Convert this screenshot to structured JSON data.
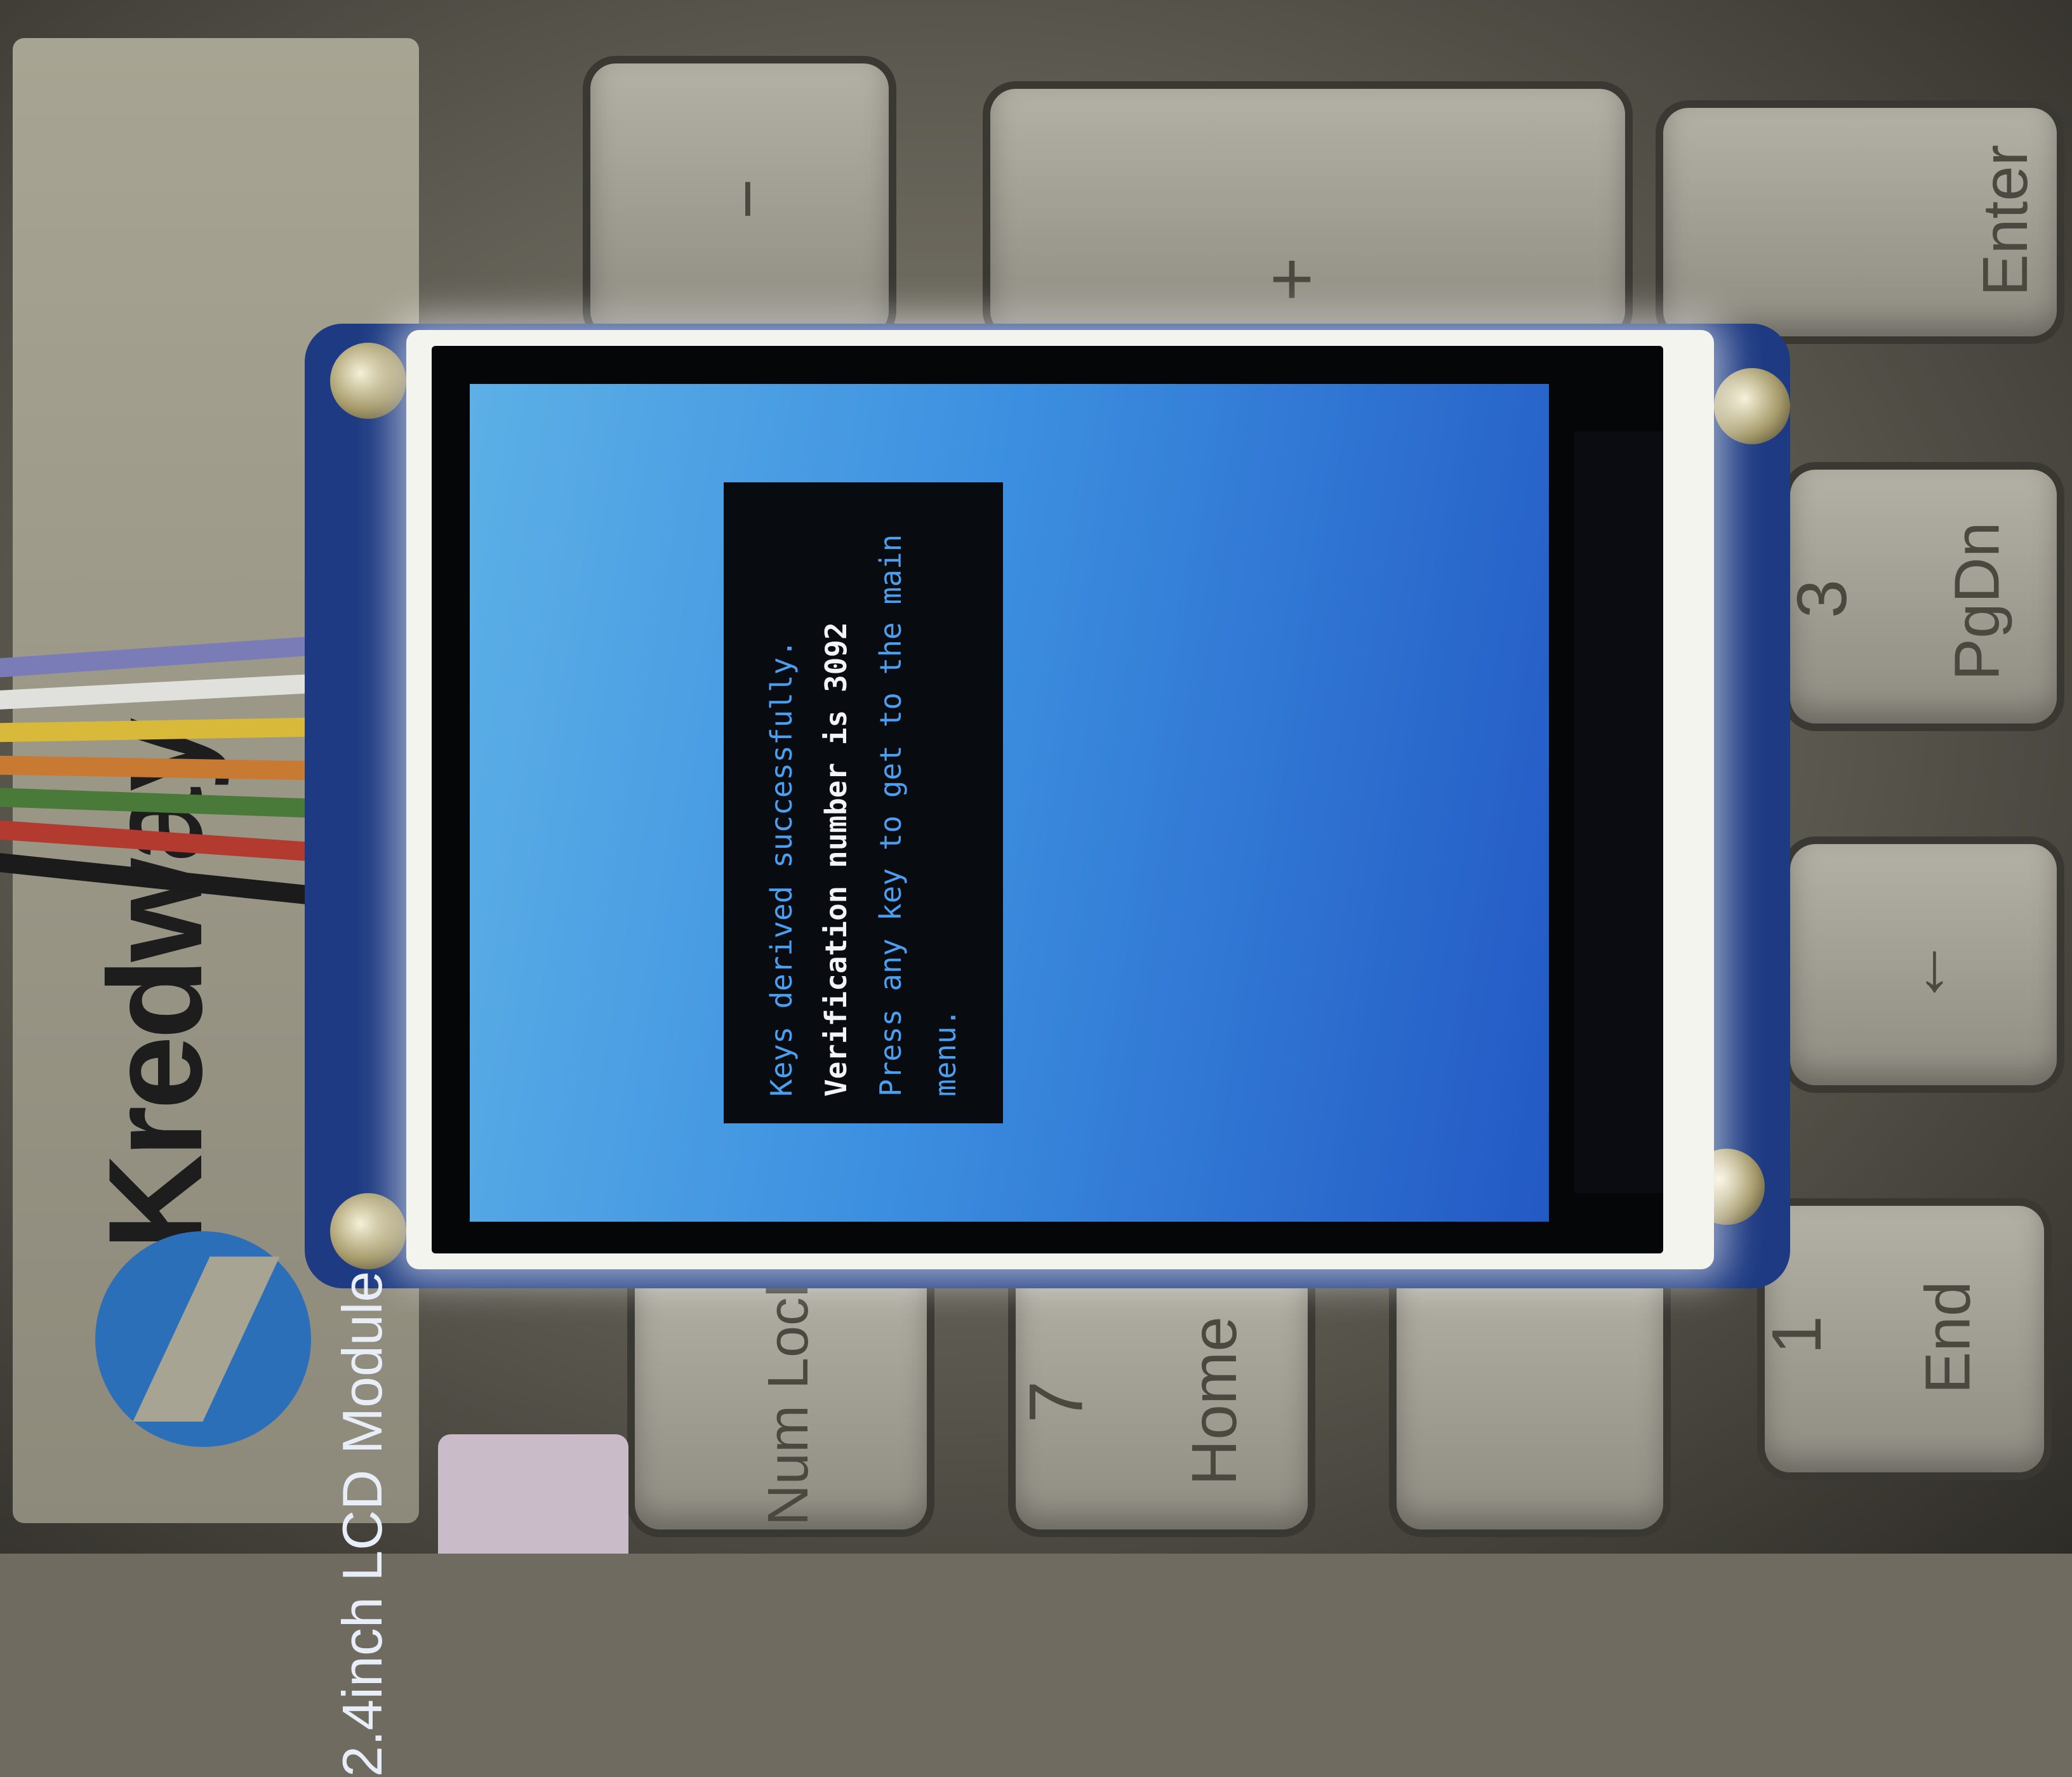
{
  "pcb": {
    "label": "2.4inch LCD Module"
  },
  "brand": {
    "text": "Kredway"
  },
  "keys": {
    "minus": "−",
    "plus": "+",
    "enter": "Enter",
    "pgdn_num": "3",
    "pgdn": "PgDn",
    "down_arrow": "↓",
    "num_lock": "Num Lock",
    "home_num": "7",
    "home": "Home",
    "end_num": "1",
    "end": "End"
  },
  "screen": {
    "line1": "Keys derived successfully.",
    "line2": "Verification number is 3092",
    "line3": "Press any key to get to the main menu."
  },
  "colors": {
    "screen_light": "#5cb0e6",
    "screen_dark": "#2359c4",
    "dialog_bg": "#080b10",
    "text_blue": "#4a9ff0",
    "text_white": "#f2f4f7",
    "pcb": "#1d3a82"
  }
}
